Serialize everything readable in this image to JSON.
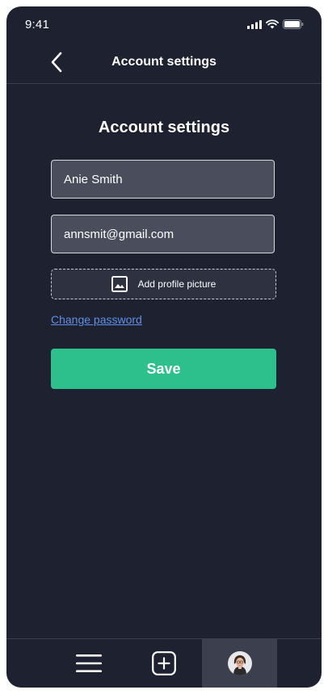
{
  "status_bar": {
    "time": "9:41"
  },
  "header": {
    "title": "Account settings",
    "back_icon": "chevron-left-icon"
  },
  "main": {
    "title": "Account settings",
    "name_value": "Anie Smith",
    "email_value": "annsmit@gmail.com",
    "upload_label": "Add profile picture",
    "upload_icon": "image-icon",
    "change_password_label": "Change password",
    "save_label": "Save"
  },
  "bottom_nav": {
    "items": [
      {
        "icon": "menu-icon"
      },
      {
        "icon": "add-square-icon"
      },
      {
        "icon": "avatar",
        "active": true
      }
    ]
  },
  "colors": {
    "background": "#1e2130",
    "field_background": "#4a4e5c",
    "accent_green": "#2dc08c",
    "link_blue": "#5f8fe8",
    "active_nav": "#3b3f4e"
  }
}
